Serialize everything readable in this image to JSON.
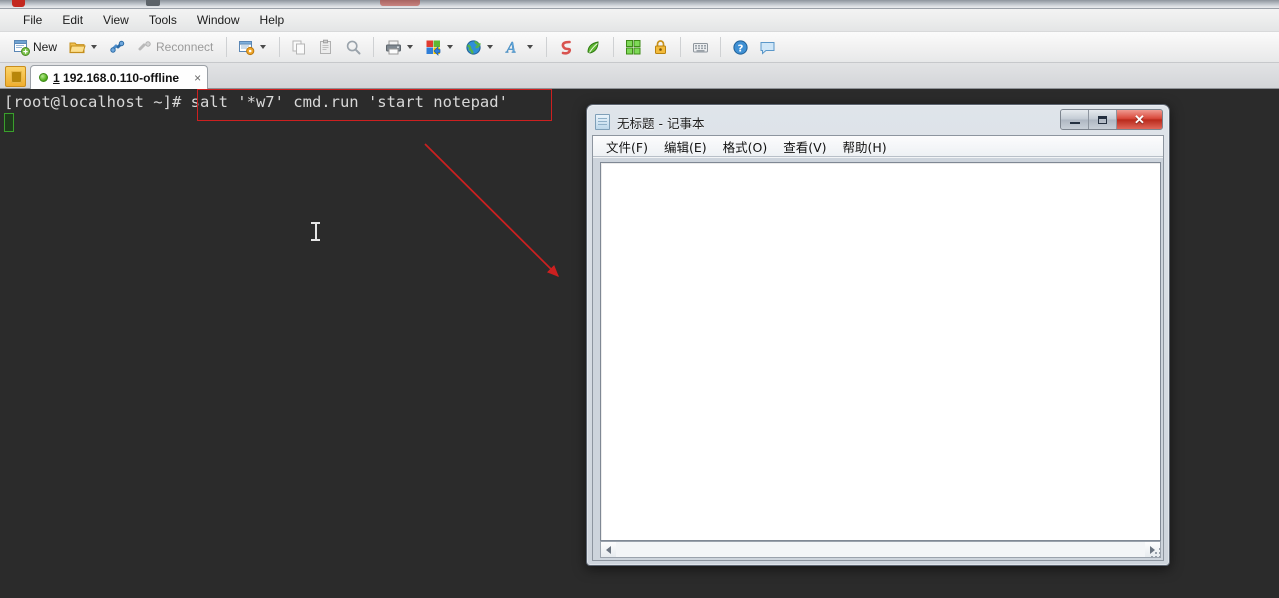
{
  "app": {
    "menubar": [
      {
        "label": "File"
      },
      {
        "label": "Edit"
      },
      {
        "label": "View"
      },
      {
        "label": "Tools"
      },
      {
        "label": "Window"
      },
      {
        "label": "Help"
      }
    ],
    "toolbar": {
      "new_label": "New",
      "reconnect_label": "Reconnect",
      "icons": [
        "new-session-icon",
        "open-folder-icon",
        "connect-link-icon",
        "reconnect-icon",
        "session-options-icon",
        "copy-icon",
        "paste-icon",
        "find-icon",
        "print-icon",
        "transfer-icon",
        "web-browser-icon",
        "ansi-color-icon",
        "script-run-icon",
        "log-session-icon",
        "tile-windows-icon",
        "lock-icon",
        "keymap-editor-icon",
        "help-icon",
        "chat-icon"
      ]
    },
    "tab": {
      "index": "1",
      "title": " 192.168.0.110-offline",
      "close_label": "×",
      "status_color": "#59b521"
    }
  },
  "terminal": {
    "prompt": "[root@localhost ~]# ",
    "command": "salt '*w7' cmd.run 'start notepad'",
    "full_line": "[root@localhost ~]# salt '*w7' cmd.run 'start notepad'",
    "cursor_color": "#3aa02c",
    "background": "#2b2b2b",
    "foreground": "#d8d8d8"
  },
  "annotations": {
    "highlight_box_color": "#cc2020",
    "arrow_color": "#cc2020",
    "arrow_from": "425,144",
    "arrow_to": "563,280"
  },
  "notepad": {
    "title": "无标题 - 记事本",
    "menu": [
      {
        "label": "文件(F)"
      },
      {
        "label": "编辑(E)"
      },
      {
        "label": "格式(O)"
      },
      {
        "label": "查看(V)"
      },
      {
        "label": "帮助(H)"
      }
    ],
    "content": "",
    "controls": {
      "minimize": "minimize",
      "maximize": "maximize",
      "close": "✕"
    }
  }
}
